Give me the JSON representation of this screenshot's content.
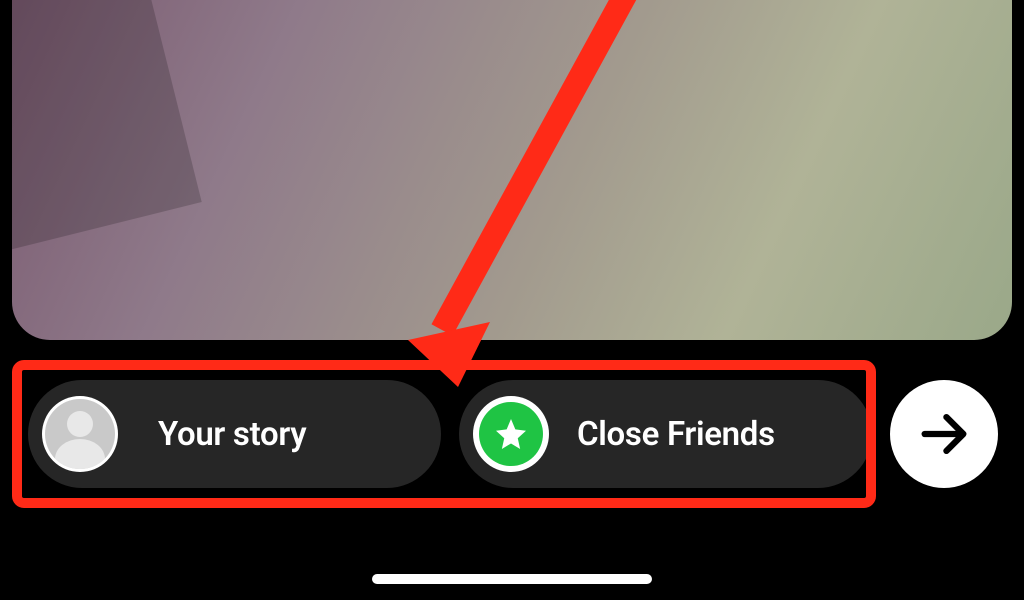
{
  "share": {
    "your_story_label": "Your story",
    "close_friends_label": "Close Friends"
  },
  "colors": {
    "highlight": "#ff2a17",
    "close_friends_green": "#1fc444",
    "pill_bg": "#262626"
  }
}
